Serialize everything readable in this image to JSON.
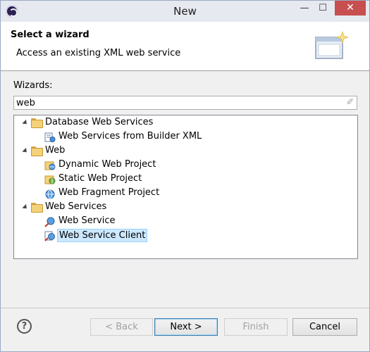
{
  "window": {
    "title": "New",
    "minimize": "—",
    "maximize": "☐",
    "close": "✕"
  },
  "header": {
    "title": "Select a wizard",
    "description": "Access an existing XML web service"
  },
  "wizards_label": "Wizards:",
  "filter": {
    "value": "web",
    "placeholder": ""
  },
  "tree": {
    "groups": [
      {
        "label": "Database Web Services",
        "expanded": true,
        "items": [
          {
            "label": "Web Services from Builder XML",
            "icon": "web-services-builder-icon",
            "selected": false
          }
        ]
      },
      {
        "label": "Web",
        "expanded": true,
        "items": [
          {
            "label": "Dynamic Web Project",
            "icon": "dynamic-web-project-icon",
            "selected": false
          },
          {
            "label": "Static Web Project",
            "icon": "static-web-project-icon",
            "selected": false
          },
          {
            "label": "Web Fragment Project",
            "icon": "web-fragment-project-icon",
            "selected": false
          }
        ]
      },
      {
        "label": "Web Services",
        "expanded": true,
        "items": [
          {
            "label": "Web Service",
            "icon": "web-service-icon",
            "selected": false
          },
          {
            "label": "Web Service Client",
            "icon": "web-service-client-icon",
            "selected": true
          }
        ]
      }
    ]
  },
  "buttons": {
    "help": "?",
    "back": "< Back",
    "next": "Next >",
    "finish": "Finish",
    "cancel": "Cancel"
  },
  "colors": {
    "selection_bg": "#cce8ff",
    "selection_border": "#99d1ff",
    "close_button": "#c74f4f",
    "default_button_border": "#3c7fb1"
  }
}
